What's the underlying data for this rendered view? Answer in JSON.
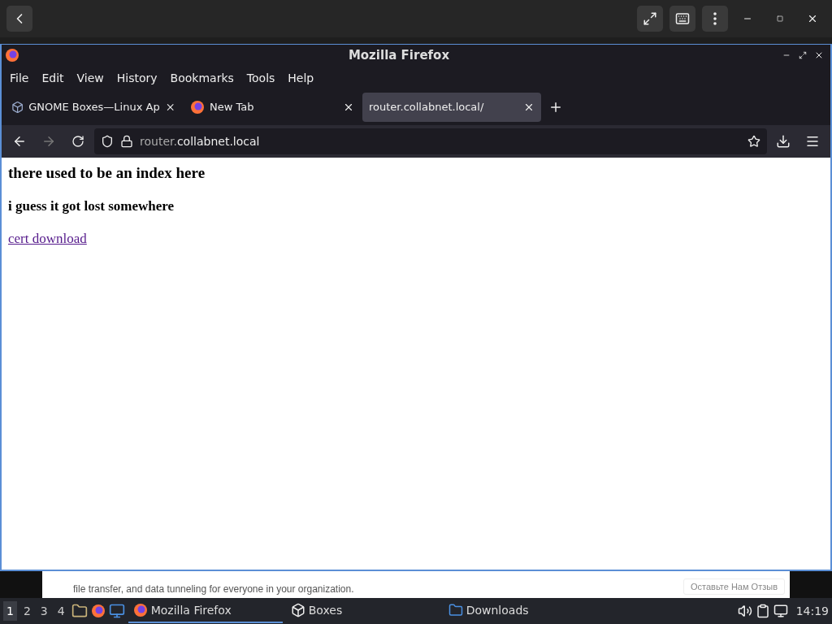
{
  "window": {
    "title": "Mozilla Firefox"
  },
  "menu": [
    "File",
    "Edit",
    "View",
    "History",
    "Bookmarks",
    "Tools",
    "Help"
  ],
  "tabs": [
    {
      "label": "GNOME Boxes—Linux Ap",
      "selected": false,
      "kind": "boxes"
    },
    {
      "label": "New Tab",
      "selected": false,
      "kind": "firefox"
    },
    {
      "label": "router.collabnet.local/",
      "selected": true,
      "kind": "none"
    }
  ],
  "address": {
    "host_prefix": "router.",
    "host": "collabnet.local"
  },
  "page": {
    "heading": "there used to be an index here",
    "subheading": "i guess it got lost somewhere",
    "link": "cert download"
  },
  "background_page": {
    "text": "file transfer, and data tunneling for everyone in your organization.",
    "button": "Оставьте Нам Отзыв"
  },
  "taskbar": {
    "workspaces": [
      {
        "label": "1",
        "selected": true
      },
      {
        "label": "2",
        "selected": false
      },
      {
        "label": "3",
        "selected": false
      },
      {
        "label": "4",
        "selected": false
      }
    ],
    "tasks": [
      {
        "label": "Mozilla Firefox",
        "kind": "firefox",
        "selected": true
      },
      {
        "label": "Boxes",
        "kind": "boxes",
        "selected": false
      },
      {
        "label": "Downloads",
        "kind": "folder",
        "selected": false
      }
    ],
    "clock": "14:19"
  }
}
